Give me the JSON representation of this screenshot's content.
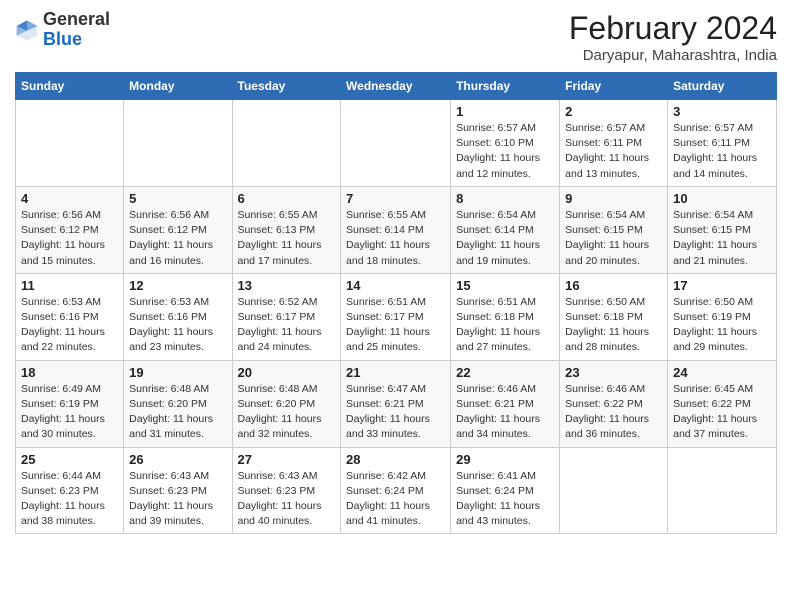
{
  "logo": {
    "general": "General",
    "blue": "Blue"
  },
  "title": {
    "month_year": "February 2024",
    "location": "Daryapur, Maharashtra, India"
  },
  "days_of_week": [
    "Sunday",
    "Monday",
    "Tuesday",
    "Wednesday",
    "Thursday",
    "Friday",
    "Saturday"
  ],
  "weeks": [
    [
      {
        "day": "",
        "info": ""
      },
      {
        "day": "",
        "info": ""
      },
      {
        "day": "",
        "info": ""
      },
      {
        "day": "",
        "info": ""
      },
      {
        "day": "1",
        "info": "Sunrise: 6:57 AM\nSunset: 6:10 PM\nDaylight: 11 hours\nand 12 minutes."
      },
      {
        "day": "2",
        "info": "Sunrise: 6:57 AM\nSunset: 6:11 PM\nDaylight: 11 hours\nand 13 minutes."
      },
      {
        "day": "3",
        "info": "Sunrise: 6:57 AM\nSunset: 6:11 PM\nDaylight: 11 hours\nand 14 minutes."
      }
    ],
    [
      {
        "day": "4",
        "info": "Sunrise: 6:56 AM\nSunset: 6:12 PM\nDaylight: 11 hours\nand 15 minutes."
      },
      {
        "day": "5",
        "info": "Sunrise: 6:56 AM\nSunset: 6:12 PM\nDaylight: 11 hours\nand 16 minutes."
      },
      {
        "day": "6",
        "info": "Sunrise: 6:55 AM\nSunset: 6:13 PM\nDaylight: 11 hours\nand 17 minutes."
      },
      {
        "day": "7",
        "info": "Sunrise: 6:55 AM\nSunset: 6:14 PM\nDaylight: 11 hours\nand 18 minutes."
      },
      {
        "day": "8",
        "info": "Sunrise: 6:54 AM\nSunset: 6:14 PM\nDaylight: 11 hours\nand 19 minutes."
      },
      {
        "day": "9",
        "info": "Sunrise: 6:54 AM\nSunset: 6:15 PM\nDaylight: 11 hours\nand 20 minutes."
      },
      {
        "day": "10",
        "info": "Sunrise: 6:54 AM\nSunset: 6:15 PM\nDaylight: 11 hours\nand 21 minutes."
      }
    ],
    [
      {
        "day": "11",
        "info": "Sunrise: 6:53 AM\nSunset: 6:16 PM\nDaylight: 11 hours\nand 22 minutes."
      },
      {
        "day": "12",
        "info": "Sunrise: 6:53 AM\nSunset: 6:16 PM\nDaylight: 11 hours\nand 23 minutes."
      },
      {
        "day": "13",
        "info": "Sunrise: 6:52 AM\nSunset: 6:17 PM\nDaylight: 11 hours\nand 24 minutes."
      },
      {
        "day": "14",
        "info": "Sunrise: 6:51 AM\nSunset: 6:17 PM\nDaylight: 11 hours\nand 25 minutes."
      },
      {
        "day": "15",
        "info": "Sunrise: 6:51 AM\nSunset: 6:18 PM\nDaylight: 11 hours\nand 27 minutes."
      },
      {
        "day": "16",
        "info": "Sunrise: 6:50 AM\nSunset: 6:18 PM\nDaylight: 11 hours\nand 28 minutes."
      },
      {
        "day": "17",
        "info": "Sunrise: 6:50 AM\nSunset: 6:19 PM\nDaylight: 11 hours\nand 29 minutes."
      }
    ],
    [
      {
        "day": "18",
        "info": "Sunrise: 6:49 AM\nSunset: 6:19 PM\nDaylight: 11 hours\nand 30 minutes."
      },
      {
        "day": "19",
        "info": "Sunrise: 6:48 AM\nSunset: 6:20 PM\nDaylight: 11 hours\nand 31 minutes."
      },
      {
        "day": "20",
        "info": "Sunrise: 6:48 AM\nSunset: 6:20 PM\nDaylight: 11 hours\nand 32 minutes."
      },
      {
        "day": "21",
        "info": "Sunrise: 6:47 AM\nSunset: 6:21 PM\nDaylight: 11 hours\nand 33 minutes."
      },
      {
        "day": "22",
        "info": "Sunrise: 6:46 AM\nSunset: 6:21 PM\nDaylight: 11 hours\nand 34 minutes."
      },
      {
        "day": "23",
        "info": "Sunrise: 6:46 AM\nSunset: 6:22 PM\nDaylight: 11 hours\nand 36 minutes."
      },
      {
        "day": "24",
        "info": "Sunrise: 6:45 AM\nSunset: 6:22 PM\nDaylight: 11 hours\nand 37 minutes."
      }
    ],
    [
      {
        "day": "25",
        "info": "Sunrise: 6:44 AM\nSunset: 6:23 PM\nDaylight: 11 hours\nand 38 minutes."
      },
      {
        "day": "26",
        "info": "Sunrise: 6:43 AM\nSunset: 6:23 PM\nDaylight: 11 hours\nand 39 minutes."
      },
      {
        "day": "27",
        "info": "Sunrise: 6:43 AM\nSunset: 6:23 PM\nDaylight: 11 hours\nand 40 minutes."
      },
      {
        "day": "28",
        "info": "Sunrise: 6:42 AM\nSunset: 6:24 PM\nDaylight: 11 hours\nand 41 minutes."
      },
      {
        "day": "29",
        "info": "Sunrise: 6:41 AM\nSunset: 6:24 PM\nDaylight: 11 hours\nand 43 minutes."
      },
      {
        "day": "",
        "info": ""
      },
      {
        "day": "",
        "info": ""
      }
    ]
  ]
}
